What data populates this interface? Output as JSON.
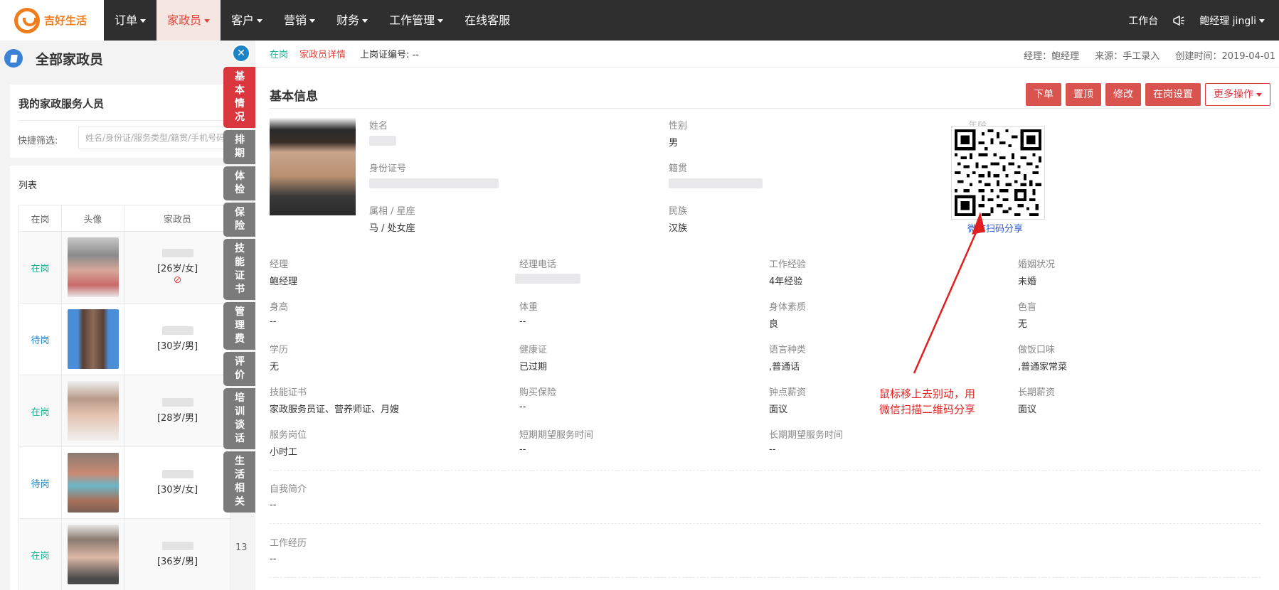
{
  "topnav": {
    "logo_text": "吉好生活",
    "items": [
      {
        "label": "订单",
        "has_caret": true
      },
      {
        "label": "家政员",
        "has_caret": true,
        "active": true
      },
      {
        "label": "客户",
        "has_caret": true
      },
      {
        "label": "营销",
        "has_caret": true
      },
      {
        "label": "财务",
        "has_caret": true
      },
      {
        "label": "工作管理",
        "has_caret": true
      },
      {
        "label": "在线客服",
        "has_caret": false
      }
    ],
    "workbench": "工作台",
    "user": "鲍经理 jingli",
    "accent_color": "#f07d1d"
  },
  "left": {
    "title": "全部家政员",
    "card_title": "我的家政服务人员",
    "filter_label": "快捷筛选:",
    "filter_placeholder": "姓名/身份证/服务类型/籍贯/手机号码",
    "list_title": "列表",
    "columns": [
      "在岗",
      "头像",
      "家政员"
    ],
    "rows": [
      {
        "status": "在岗",
        "info": "[26岁/女]",
        "banned": true
      },
      {
        "status": "待岗",
        "info": "[30岁/男]",
        "banned": false
      },
      {
        "status": "在岗",
        "info": "[28岁/男]",
        "banned": false
      },
      {
        "status": "待岗",
        "info": "[30岁/女]",
        "banned": false
      },
      {
        "status": "在岗",
        "info": "[36岁/男]",
        "banned": false
      }
    ],
    "extra_col_peek": "13"
  },
  "tabs": [
    {
      "label": "基本情况",
      "active": true
    },
    {
      "label": "排期",
      "active": false
    },
    {
      "label": "体检",
      "active": false
    },
    {
      "label": "保险",
      "active": false
    },
    {
      "label": "技能证书",
      "active": false
    },
    {
      "label": "管理费",
      "active": false
    },
    {
      "label": "评价",
      "active": false
    },
    {
      "label": "培训谈话",
      "active": false
    },
    {
      "label": "生活相关",
      "active": false
    }
  ],
  "detail": {
    "status": "在岗",
    "link": "家政员详情",
    "cert_label": "上岗证编号:",
    "cert_value": "--",
    "manager": "经理：鲍经理",
    "source": "来源：手工录入",
    "created": "创建时间：2019-04-01",
    "section_title": "基本信息",
    "actions": [
      "下单",
      "置顶",
      "修改",
      "在岗设置"
    ],
    "more_actions": "更多操作",
    "fields": {
      "name_label": "姓名",
      "gender_label": "性别",
      "gender": "男",
      "age_label": "年龄",
      "id_label": "身份证号",
      "native_label": "籍贯",
      "zodiac_label": "属相 / 星座",
      "zodiac": "马 / 处女座",
      "ethnicity_label": "民族",
      "ethnicity": "汉族"
    },
    "qr_label": "微信扫码分享",
    "grid": [
      [
        {
          "label": "经理",
          "value": "鲍经理"
        },
        {
          "label": "经理电话",
          "value": ""
        },
        {
          "label": "工作经验",
          "value": "4年经验"
        },
        {
          "label": "婚姻状况",
          "value": "未婚"
        }
      ],
      [
        {
          "label": "身高",
          "value": "--"
        },
        {
          "label": "体重",
          "value": "--"
        },
        {
          "label": "身体素质",
          "value": "良"
        },
        {
          "label": "色盲",
          "value": "无"
        }
      ],
      [
        {
          "label": "学历",
          "value": "无"
        },
        {
          "label": "健康证",
          "value": "已过期"
        },
        {
          "label": "语言种类",
          "value": ",普通话"
        },
        {
          "label": "做饭口味",
          "value": ",普通家常菜"
        }
      ],
      [
        {
          "label": "技能证书",
          "value": "家政服务员证、营养师证、月嫂"
        },
        {
          "label": "购买保险",
          "value": "--"
        },
        {
          "label": "钟点薪资",
          "value": "面议"
        },
        {
          "label": "长期薪资",
          "value": "面议"
        }
      ],
      [
        {
          "label": "服务岗位",
          "value": "小时工"
        },
        {
          "label": "短期期望服务时间",
          "value": "--"
        },
        {
          "label": "长期期望服务时间",
          "value": "--"
        }
      ]
    ],
    "intro_label": "自我简介",
    "intro_value": "--",
    "history_label": "工作经历",
    "history_value": "--"
  },
  "annotation": {
    "line1": "鼠标移上去别动，用",
    "line2": "微信扫描二维码分享"
  }
}
